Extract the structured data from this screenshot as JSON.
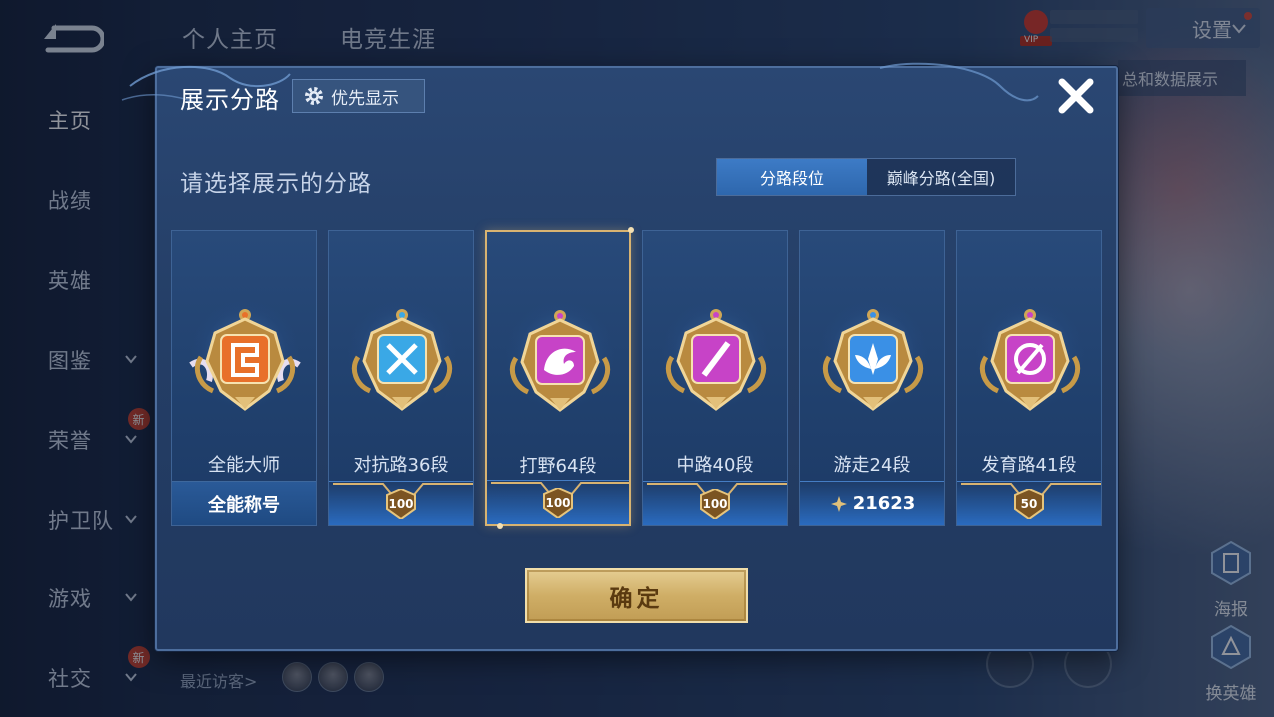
{
  "top_tabs": [
    "个人主页",
    "电竞生涯"
  ],
  "left_nav": [
    {
      "label": "主页",
      "active": true,
      "chevron": false,
      "new": false
    },
    {
      "label": "战绩",
      "active": false,
      "chevron": false,
      "new": false
    },
    {
      "label": "英雄",
      "active": false,
      "chevron": false,
      "new": false
    },
    {
      "label": "图鉴",
      "active": false,
      "chevron": true,
      "new": false
    },
    {
      "label": "荣誉",
      "active": false,
      "chevron": true,
      "new": true
    },
    {
      "label": "护卫队",
      "active": false,
      "chevron": true,
      "new": false
    },
    {
      "label": "游戏",
      "active": false,
      "chevron": true,
      "new": false
    },
    {
      "label": "社交",
      "active": false,
      "chevron": true,
      "new": true
    }
  ],
  "new_tag": "新",
  "header": {
    "settings_label": "设置",
    "vip_label": "VIP",
    "right_strip": "总和数据展示"
  },
  "bottom": {
    "recent_visitors": "最近访客>"
  },
  "side_buttons": {
    "report": "海报",
    "switch_hero": "换英雄"
  },
  "modal": {
    "title": "展示分路",
    "priority_label": "优先显示",
    "subtitle": "请选择展示的分路",
    "toggle": {
      "active": "分路段位",
      "inactive": "巅峰分路(全国)"
    },
    "confirm_label": "确定"
  },
  "cards": [
    {
      "name": "全能大师",
      "footer_type": "title",
      "footer_text": "全能称号",
      "color": "#e8702a",
      "selected": false
    },
    {
      "name": "对抗路36段",
      "footer_type": "star",
      "footer_text": "100",
      "color": "#3aa8e6",
      "selected": false
    },
    {
      "name": "打野64段",
      "footer_type": "star",
      "footer_text": "100",
      "color": "#c743c7",
      "selected": true
    },
    {
      "name": "中路40段",
      "footer_type": "star",
      "footer_text": "100",
      "color": "#c743c7",
      "selected": false
    },
    {
      "name": "游走24段",
      "footer_type": "points",
      "footer_text": "21623",
      "color": "#3a90e6",
      "selected": false
    },
    {
      "name": "发育路41段",
      "footer_type": "star",
      "footer_text": "50",
      "color": "#c743c7",
      "selected": false
    }
  ],
  "colors": {
    "accent_gold": "#d8b371",
    "toggle_active": "#3d7bc6",
    "confirm_text": "#5a3a10"
  }
}
